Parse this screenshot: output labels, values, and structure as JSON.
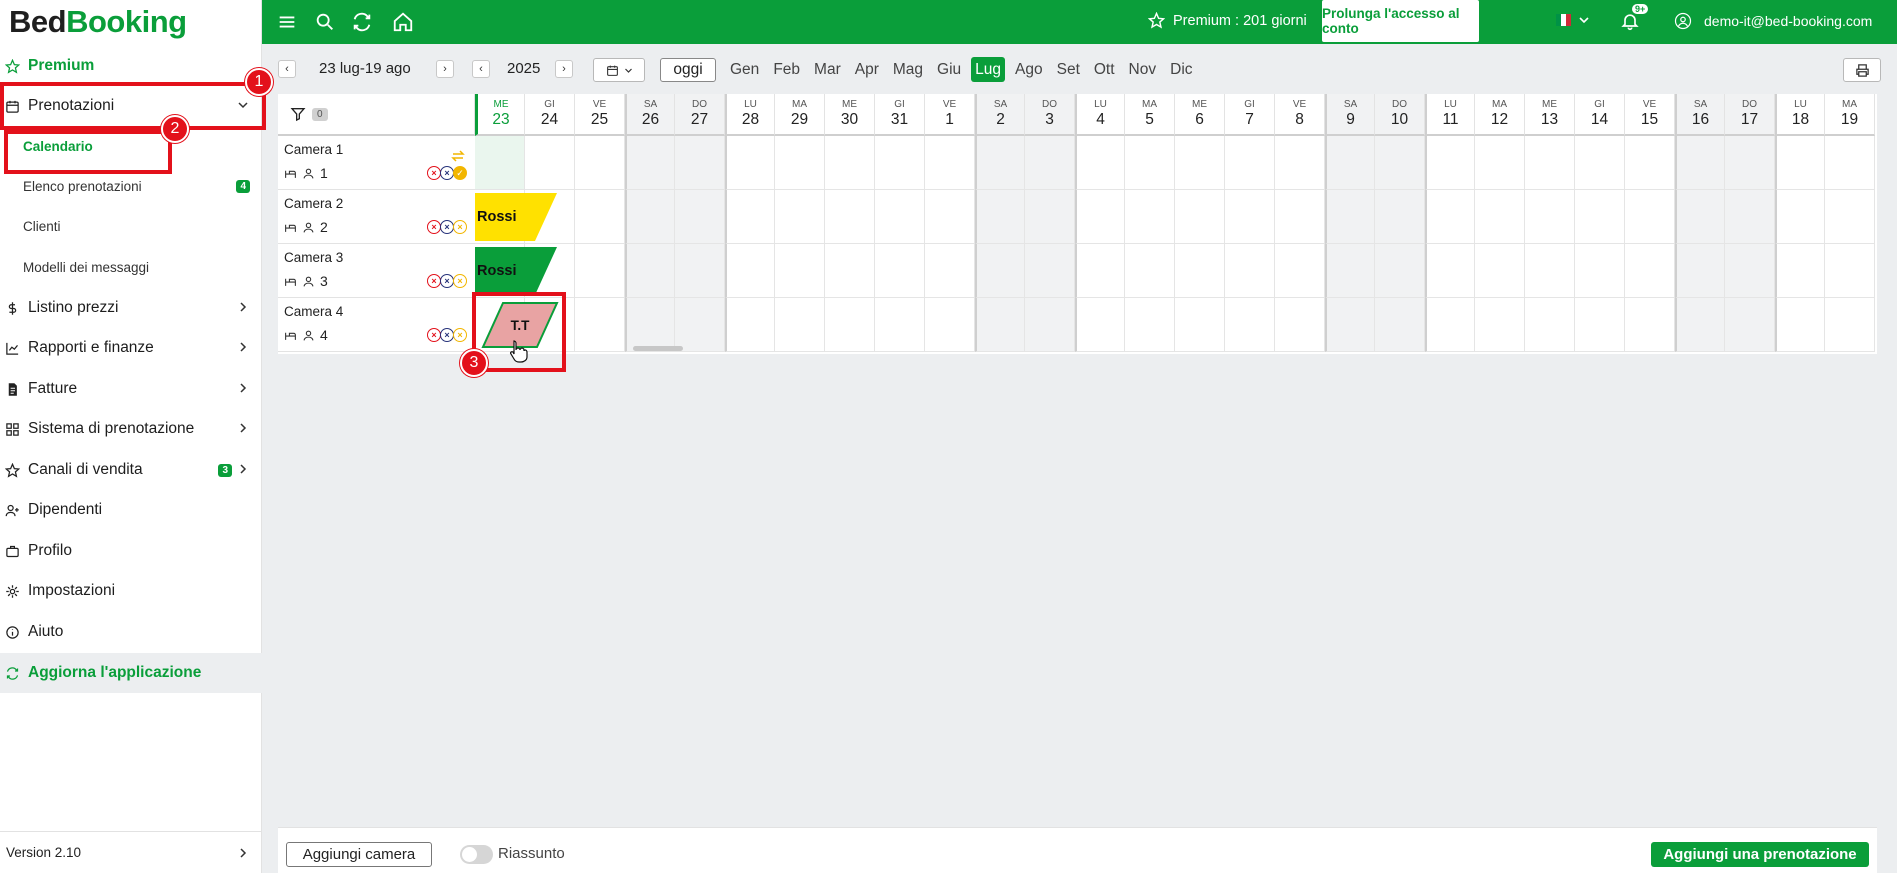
{
  "brand": {
    "part1": "Bed",
    "part2": "Booking"
  },
  "sidebar": {
    "items": [
      {
        "label": "Premium",
        "icon": "star-icon"
      },
      {
        "label": "Prenotazioni",
        "icon": "calendar-icon"
      },
      {
        "label": "Calendario"
      },
      {
        "label": "Elenco prenotazioni",
        "badge": "4"
      },
      {
        "label": "Clienti"
      },
      {
        "label": "Modelli dei messaggi"
      },
      {
        "label": "Listino prezzi",
        "icon": "dollar-icon"
      },
      {
        "label": "Rapporti e finanze",
        "icon": "chart-icon"
      },
      {
        "label": "Fatture",
        "icon": "invoice-icon"
      },
      {
        "label": "Sistema di prenotazione",
        "icon": "grid-icon"
      },
      {
        "label": "Canali di vendita",
        "icon": "star-icon",
        "badge": "3"
      },
      {
        "label": "Dipendenti",
        "icon": "user-plus-icon"
      },
      {
        "label": "Profilo",
        "icon": "briefcase-icon"
      },
      {
        "label": "Impostazioni",
        "icon": "gear-icon"
      },
      {
        "label": "Aiuto",
        "icon": "info-icon"
      },
      {
        "label": "Aggiorna l'applicazione",
        "icon": "refresh-icon"
      }
    ],
    "version": "Version 2.10"
  },
  "annotations": {
    "m1": "1",
    "m2": "2",
    "m3": "3"
  },
  "topbar": {
    "premium": "Premium : 201 giorni",
    "extend": "Prolunga l'accesso al conto",
    "notifications": "9+",
    "user": "demo-it@bed-booking.com"
  },
  "toolbar": {
    "range": "23 lug-19 ago",
    "year": "2025",
    "today": "oggi",
    "months": [
      "Gen",
      "Feb",
      "Mar",
      "Apr",
      "Mag",
      "Giu",
      "Lug",
      "Ago",
      "Set",
      "Ott",
      "Nov",
      "Dic"
    ],
    "active_month": "Lug"
  },
  "grid": {
    "filter_count": "0",
    "days": [
      {
        "w": "ME",
        "d": "23"
      },
      {
        "w": "GI",
        "d": "24"
      },
      {
        "w": "VE",
        "d": "25"
      },
      {
        "w": "SA",
        "d": "26"
      },
      {
        "w": "DO",
        "d": "27"
      },
      {
        "w": "LU",
        "d": "28"
      },
      {
        "w": "MA",
        "d": "29"
      },
      {
        "w": "ME",
        "d": "30"
      },
      {
        "w": "GI",
        "d": "31"
      },
      {
        "w": "VE",
        "d": "1"
      },
      {
        "w": "SA",
        "d": "2"
      },
      {
        "w": "DO",
        "d": "3"
      },
      {
        "w": "LU",
        "d": "4"
      },
      {
        "w": "MA",
        "d": "5"
      },
      {
        "w": "ME",
        "d": "6"
      },
      {
        "w": "GI",
        "d": "7"
      },
      {
        "w": "VE",
        "d": "8"
      },
      {
        "w": "SA",
        "d": "9"
      },
      {
        "w": "DO",
        "d": "10"
      },
      {
        "w": "LU",
        "d": "11"
      },
      {
        "w": "MA",
        "d": "12"
      },
      {
        "w": "ME",
        "d": "13"
      },
      {
        "w": "GI",
        "d": "14"
      },
      {
        "w": "VE",
        "d": "15"
      },
      {
        "w": "SA",
        "d": "16"
      },
      {
        "w": "DO",
        "d": "17"
      },
      {
        "w": "LU",
        "d": "18"
      },
      {
        "w": "MA",
        "d": "19"
      }
    ],
    "rooms": [
      {
        "name": "Camera 1",
        "guests": "1"
      },
      {
        "name": "Camera 2",
        "guests": "2"
      },
      {
        "name": "Camera 3",
        "guests": "3"
      },
      {
        "name": "Camera 4",
        "guests": "4"
      }
    ],
    "bookings": [
      {
        "room": 1,
        "label": "Rossi",
        "color": "#ffe100"
      },
      {
        "room": 2,
        "label": "Rossi",
        "color": "#0a9e3a"
      },
      {
        "room": 3,
        "label": "T.T",
        "color": "#e8a3a3"
      }
    ]
  },
  "footer": {
    "add_room": "Aggiungi camera",
    "summary": "Riassunto",
    "add_booking": "Aggiungi una prenotazione"
  },
  "colors": {
    "brand_green": "#0a9e3a",
    "highlight_red": "#e3111b"
  }
}
